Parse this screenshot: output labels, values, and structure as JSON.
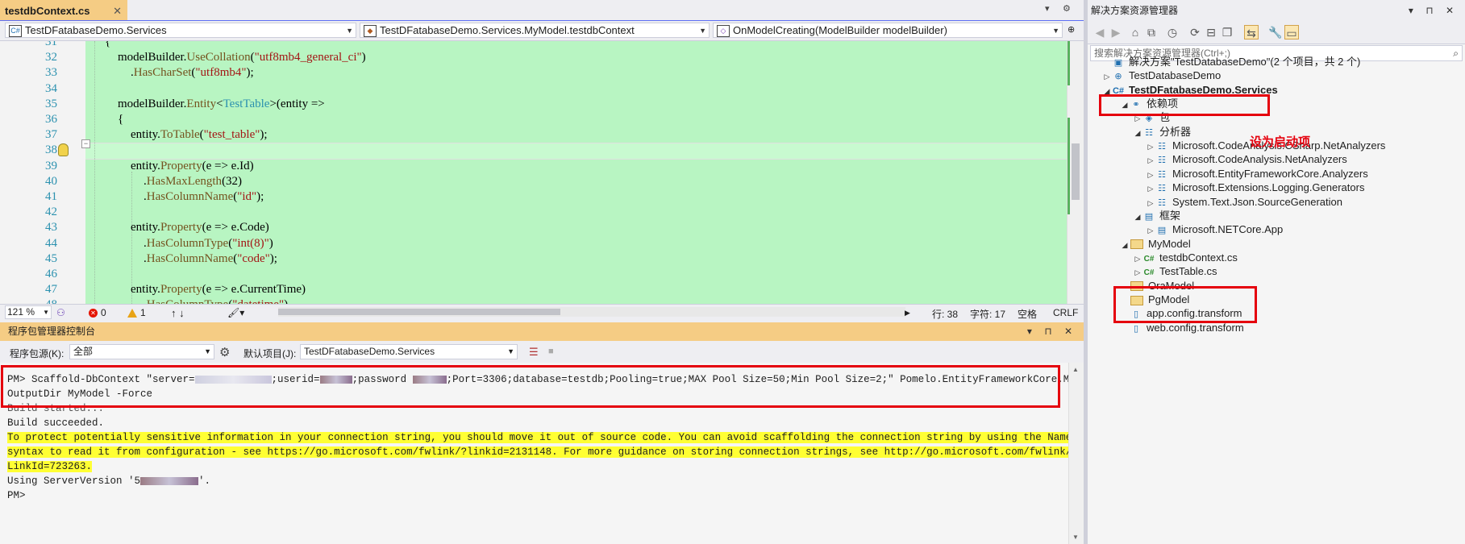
{
  "editor": {
    "tab": {
      "title": "testdbContext.cs",
      "close": "✕"
    },
    "tabstrip_buttons": [
      "▾",
      "⚙"
    ],
    "nav": {
      "project": "TestDFatabaseDemo.Services",
      "class": "TestDFatabaseDemo.Services.MyModel.testdbContext",
      "member": "OnModelCreating(ModelBuilder modelBuilder)"
    },
    "lines": [
      {
        "no": "31",
        "segs": [
          {
            "t": "{",
            "c": "n"
          }
        ],
        "indent": 1
      },
      {
        "no": "32",
        "segs": [
          {
            "t": "modelBuilder.",
            "c": "n"
          },
          {
            "t": "UseCollation",
            "c": "m"
          },
          {
            "t": "(",
            "c": "n"
          },
          {
            "t": "\"utf8mb4_general_ci\"",
            "c": "s"
          },
          {
            "t": ")",
            "c": "n"
          }
        ],
        "indent": 2
      },
      {
        "no": "33",
        "segs": [
          {
            "t": ".",
            "c": "n"
          },
          {
            "t": "HasCharSet",
            "c": "m"
          },
          {
            "t": "(",
            "c": "n"
          },
          {
            "t": "\"utf8mb4\"",
            "c": "s"
          },
          {
            "t": ");",
            "c": "n"
          }
        ],
        "indent": 3
      },
      {
        "no": "34",
        "segs": [],
        "indent": 0
      },
      {
        "no": "35",
        "segs": [
          {
            "t": "modelBuilder.",
            "c": "n"
          },
          {
            "t": "Entity",
            "c": "m"
          },
          {
            "t": "<",
            "c": "n"
          },
          {
            "t": "TestTable",
            "c": "t"
          },
          {
            "t": ">(entity =>",
            "c": "n"
          }
        ],
        "indent": 2
      },
      {
        "no": "36",
        "segs": [
          {
            "t": "{",
            "c": "n"
          }
        ],
        "indent": 2
      },
      {
        "no": "37",
        "segs": [
          {
            "t": "entity.",
            "c": "n"
          },
          {
            "t": "ToTable",
            "c": "m"
          },
          {
            "t": "(",
            "c": "n"
          },
          {
            "t": "\"test_table\"",
            "c": "s"
          },
          {
            "t": ");",
            "c": "n"
          }
        ],
        "indent": 3
      },
      {
        "no": "38",
        "segs": [],
        "indent": 0
      },
      {
        "no": "39",
        "segs": [
          {
            "t": "entity.",
            "c": "n"
          },
          {
            "t": "Property",
            "c": "m"
          },
          {
            "t": "(e => e.Id)",
            "c": "n"
          }
        ],
        "indent": 3
      },
      {
        "no": "40",
        "segs": [
          {
            "t": ".",
            "c": "n"
          },
          {
            "t": "HasMaxLength",
            "c": "m"
          },
          {
            "t": "(32)",
            "c": "n"
          }
        ],
        "indent": 4
      },
      {
        "no": "41",
        "segs": [
          {
            "t": ".",
            "c": "n"
          },
          {
            "t": "HasColumnName",
            "c": "m"
          },
          {
            "t": "(",
            "c": "n"
          },
          {
            "t": "\"id\"",
            "c": "s"
          },
          {
            "t": ");",
            "c": "n"
          }
        ],
        "indent": 4
      },
      {
        "no": "42",
        "segs": [],
        "indent": 0
      },
      {
        "no": "43",
        "segs": [
          {
            "t": "entity.",
            "c": "n"
          },
          {
            "t": "Property",
            "c": "m"
          },
          {
            "t": "(e => e.Code)",
            "c": "n"
          }
        ],
        "indent": 3
      },
      {
        "no": "44",
        "segs": [
          {
            "t": ".",
            "c": "n"
          },
          {
            "t": "HasColumnType",
            "c": "m"
          },
          {
            "t": "(",
            "c": "n"
          },
          {
            "t": "\"int(8)\"",
            "c": "s"
          },
          {
            "t": ")",
            "c": "n"
          }
        ],
        "indent": 4
      },
      {
        "no": "45",
        "segs": [
          {
            "t": ".",
            "c": "n"
          },
          {
            "t": "HasColumnName",
            "c": "m"
          },
          {
            "t": "(",
            "c": "n"
          },
          {
            "t": "\"code\"",
            "c": "s"
          },
          {
            "t": ");",
            "c": "n"
          }
        ],
        "indent": 4
      },
      {
        "no": "46",
        "segs": [],
        "indent": 0
      },
      {
        "no": "47",
        "segs": [
          {
            "t": "entity.",
            "c": "n"
          },
          {
            "t": "Property",
            "c": "m"
          },
          {
            "t": "(e => e.CurrentTime)",
            "c": "n"
          }
        ],
        "indent": 3
      },
      {
        "no": "48",
        "segs": [
          {
            "t": ".",
            "c": "n"
          },
          {
            "t": "HasColumnType",
            "c": "m"
          },
          {
            "t": "(",
            "c": "n"
          },
          {
            "t": "\"datetime\"",
            "c": "s"
          },
          {
            "t": ")",
            "c": "n"
          }
        ],
        "indent": 4
      }
    ]
  },
  "status": {
    "zoom": "121 %",
    "errors": "0",
    "warnings": "1",
    "arrows": "↑  ↓",
    "line": "行: 38",
    "char": "字符: 17",
    "ws": "空格",
    "eol": "CRLF"
  },
  "pmc": {
    "title": "程序包管理器控制台",
    "title_buttons": "▾ ⊓ ✕",
    "source_label": "程序包源(K):",
    "source_value": "全部",
    "default_project_label": "默认项目(J):",
    "default_project_value": "TestDFatabaseDemo.Services",
    "cmd_prefix": "PM> Scaffold-DbContext \"server=",
    "cmd_userid": ";userid=",
    "cmd_password": ";password ",
    "cmd_rest": ";Port=3306;database=testdb;Pooling=true;MAX Pool Size=50;Min Pool Size=2;\" Pomelo.EntityFrameworkCore.MySql -",
    "cmd_line2": "OutputDir MyModel -Force",
    "build_started": "Build started...",
    "build_succeeded": "Build succeeded.",
    "warn1": "To protect potentially sensitive information in your connection string, you should move it out of source code. You can avoid scaffolding the connection string by using the Name=",
    "warn2": "syntax to read it from configuration - see https://go.microsoft.com/fwlink/?linkid=2131148. For more guidance on storing connection strings, see http://go.microsoft.com/fwlink/?",
    "warn3": "LinkId=723263.",
    "server_version_prefix": "Using ServerVersion '5",
    "server_version_suffix": "'.",
    "prompt": "PM>"
  },
  "se": {
    "title": "解决方案资源管理器",
    "title_buttons": "▾ ⊓ ✕",
    "search_placeholder": "搜索解决方案资源管理器(Ctrl+;)",
    "annotation": "设为启动项",
    "tree": [
      {
        "label": "解决方案\"TestDatabaseDemo\"(2 个项目，共 2 个)",
        "icon": "solution-icon",
        "glyph": "▣",
        "arrow": "",
        "level": 0,
        "bold": false
      },
      {
        "label": "TestDatabaseDemo",
        "icon": "web-project-icon",
        "glyph": "⊕",
        "arrow": "▷",
        "level": 0,
        "bold": false
      },
      {
        "label": "TestDFatabaseDemo.Services",
        "icon": "csharp-project-icon",
        "glyph": "C#",
        "arrow": "◢",
        "level": 0,
        "bold": true
      },
      {
        "label": "依赖项",
        "icon": "dependencies-icon",
        "glyph": "⚭",
        "arrow": "◢",
        "level": 1,
        "bold": false
      },
      {
        "label": "包",
        "icon": "package-icon",
        "glyph": "◈",
        "arrow": "▷",
        "level": 2,
        "bold": false
      },
      {
        "label": "分析器",
        "icon": "analyzer-icon",
        "glyph": "☷",
        "arrow": "◢",
        "level": 2,
        "bold": false
      },
      {
        "label": "Microsoft.CodeAnalysis.CSharp.NetAnalyzers",
        "icon": "analyzer-ref-icon",
        "glyph": "☷",
        "arrow": "▷",
        "level": 3,
        "bold": false
      },
      {
        "label": "Microsoft.CodeAnalysis.NetAnalyzers",
        "icon": "analyzer-ref-icon",
        "glyph": "☷",
        "arrow": "▷",
        "level": 3,
        "bold": false
      },
      {
        "label": "Microsoft.EntityFrameworkCore.Analyzers",
        "icon": "analyzer-ref-icon",
        "glyph": "☷",
        "arrow": "▷",
        "level": 3,
        "bold": false
      },
      {
        "label": "Microsoft.Extensions.Logging.Generators",
        "icon": "analyzer-ref-icon",
        "glyph": "☷",
        "arrow": "▷",
        "level": 3,
        "bold": false
      },
      {
        "label": "System.Text.Json.SourceGeneration",
        "icon": "analyzer-ref-icon",
        "glyph": "☷",
        "arrow": "▷",
        "level": 3,
        "bold": false
      },
      {
        "label": "框架",
        "icon": "framework-icon",
        "glyph": "▤",
        "arrow": "◢",
        "level": 2,
        "bold": false
      },
      {
        "label": "Microsoft.NETCore.App",
        "icon": "framework-ref-icon",
        "glyph": "▤",
        "arrow": "▷",
        "level": 3,
        "bold": false
      },
      {
        "label": "MyModel",
        "icon": "folder-icon",
        "glyph": "",
        "arrow": "◢",
        "level": 1,
        "bold": false
      },
      {
        "label": "testdbContext.cs",
        "icon": "csharp-file-icon",
        "glyph": "C#",
        "arrow": "▷",
        "level": 2,
        "bold": false
      },
      {
        "label": "TestTable.cs",
        "icon": "csharp-file-icon",
        "glyph": "C#",
        "arrow": "▷",
        "level": 2,
        "bold": false
      },
      {
        "label": "OraModel",
        "icon": "folder-icon",
        "glyph": "",
        "arrow": "",
        "level": 1,
        "bold": false
      },
      {
        "label": "PgModel",
        "icon": "folder-icon",
        "glyph": "",
        "arrow": "",
        "level": 1,
        "bold": false
      },
      {
        "label": "app.config.transform",
        "icon": "config-file-icon",
        "glyph": "▯",
        "arrow": "",
        "level": 1,
        "bold": false
      },
      {
        "label": "web.config.transform",
        "icon": "config-file-icon",
        "glyph": "▯",
        "arrow": "",
        "level": 1,
        "bold": false
      }
    ]
  }
}
